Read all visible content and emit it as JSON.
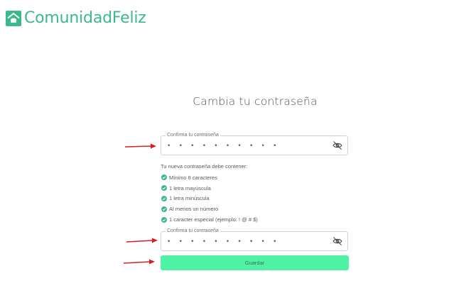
{
  "brand": {
    "name": "ComunidadFeliz",
    "color": "#3cb98a"
  },
  "page": {
    "title": "Cambia tu contraseña"
  },
  "password_field": {
    "label": "Confirma tu contraseña",
    "value": "• • • • • • • • • •"
  },
  "requirements": {
    "title": "Tu nueva contraseña debe contener:",
    "items": [
      "Mínimo 8 caracteres",
      "1 letra mayúscula",
      "1 letra minúscula",
      "Al menos un número",
      "1 caracter especial (ejemplo: ! @ # $)"
    ],
    "check_color": "#3cb98a"
  },
  "confirm_field": {
    "label": "Confirma tu contraseña",
    "value": "• • • • • • • • • •"
  },
  "actions": {
    "save_label": "Guardar",
    "save_color": "#4ff3a4"
  },
  "annotations": {
    "arrow_color": "#d62020"
  }
}
